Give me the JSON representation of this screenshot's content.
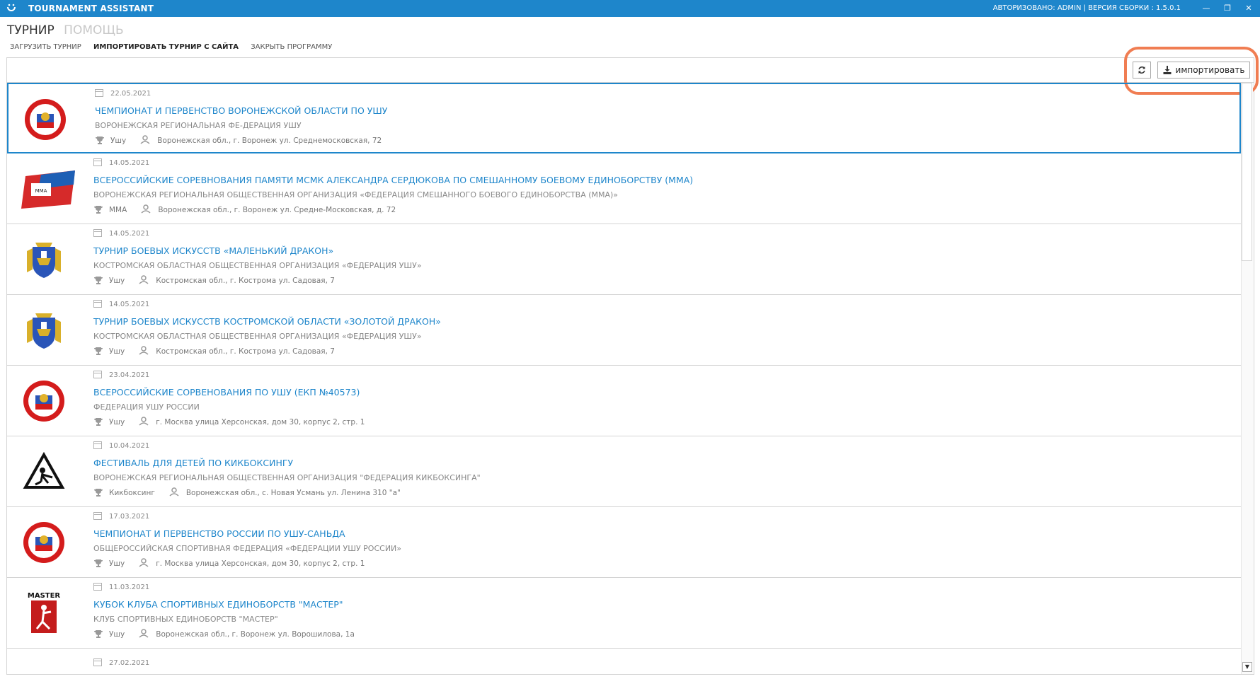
{
  "titlebar": {
    "app_title": "TOURNAMENT ASSISTANT",
    "auth_text": "АВТОРИЗОВАНО: ADMIN | ВЕРСИЯ СБОРКИ : 1.5.0.1",
    "minimize": "—",
    "restore": "❐",
    "close": "✕"
  },
  "menu": {
    "main": [
      "ТУРНИР",
      "ПОМОЩЬ"
    ],
    "sub": [
      "ЗАГРУЗИТЬ ТУРНИР",
      "ИМПОРТИРОВАТЬ ТУРНИР С САЙТА",
      "ЗАКРЫТЬ ПРОГРАММУ"
    ]
  },
  "toolbar": {
    "refresh_icon": "refresh-icon",
    "import_label": "импортировать"
  },
  "tournaments": [
    {
      "date": "22.05.2021",
      "title": "ЧЕМПИОНАТ И ПЕРВЕНСТВО ВОРОНЕЖСКОЙ ОБЛАСТИ ПО УШУ",
      "org": "ВОРОНЕЖСКАЯ РЕГИОНАЛЬНАЯ ФЕ-ДЕРАЦИЯ УШУ",
      "sport": "Ушу",
      "address": "Воронежская обл., г. Воронеж ул. Среднемосковская, 72",
      "logo": "wushu-federation-logo"
    },
    {
      "date": "14.05.2021",
      "title": "ВСЕРОССИЙСКИЕ СОРЕВНОВАНИЯ ПАМЯТИ МСМК АЛЕКСАНДРА СЕРДЮКОВА ПО СМЕШАННОМУ БОЕВОМУ ЕДИНОБОРСТВУ (ММА)",
      "org": "ВОРОНЕЖСКАЯ РЕГИОНАЛЬНАЯ ОБЩЕСТВЕННАЯ ОРГАНИЗАЦИЯ «ФЕДЕРАЦИЯ СМЕШАННОГО БОЕВОГО ЕДИНОБОРСТВА (ММА)»",
      "sport": "ММА",
      "address": "Воронежская обл., г. Воронеж ул. Средне-Московская, д. 72",
      "logo": "mma-union-logo"
    },
    {
      "date": "14.05.2021",
      "title": "ТУРНИР БОЕВЫХ ИСКУССТВ «МАЛЕНЬКИЙ ДРАКОН»",
      "org": "КОСТРОМСКАЯ ОБЛАСТНАЯ ОБЩЕСТВЕННАЯ ОРГАНИЗАЦИЯ «ФЕДЕРАЦИЯ УШУ»",
      "sport": "Ушу",
      "address": "Костромская обл., г. Кострома ул. Садовая, 7",
      "logo": "kostroma-coat-of-arms"
    },
    {
      "date": "14.05.2021",
      "title": "ТУРНИР БОЕВЫХ ИСКУССТВ КОСТРОМСКОЙ ОБЛАСТИ «ЗОЛОТОЙ ДРАКОН»",
      "org": "КОСТРОМСКАЯ ОБЛАСТНАЯ ОБЩЕСТВЕННАЯ ОРГАНИЗАЦИЯ «ФЕДЕРАЦИЯ УШУ»",
      "sport": "Ушу",
      "address": "Костромская обл., г. Кострома ул. Садовая, 7",
      "logo": "kostroma-coat-of-arms"
    },
    {
      "date": "23.04.2021",
      "title": "ВСЕРОССИЙСКИЕ СОРВЕНОВАНИЯ ПО УШУ (ЕКП №40573)",
      "org": "ФЕДЕРАЦИЯ УШУ РОССИИ",
      "sport": "Ушу",
      "address": "г. Москва улица Херсонская, дом 30, корпус 2, стр. 1",
      "logo": "wushu-federation-logo"
    },
    {
      "date": "10.04.2021",
      "title": "ФЕСТИВАЛЬ ДЛЯ ДЕТЕЙ ПО КИКБОКСИНГУ",
      "org": "ВОРОНЕЖСКАЯ РЕГИОНАЛЬНАЯ ОБЩЕСТВЕННАЯ ОРГАНИЗАЦИЯ \"ФЕДЕРАЦИЯ КИКБОКСИНГА\"",
      "sport": "Кикбоксинг",
      "address": "Воронежская обл., с. Новая Усмань ул. Ленина 310 \"а\"",
      "logo": "kickboxing-logo"
    },
    {
      "date": "17.03.2021",
      "title": "ЧЕМПИОНАТ И ПЕРВЕНСТВО РОССИИ ПО УШУ-САНЬДА",
      "org": "ОБЩЕРОССИЙСКАЯ СПОРТИВНАЯ ФЕДЕРАЦИЯ «ФЕДЕРАЦИИ УШУ РОССИИ»",
      "sport": "Ушу",
      "address": "г. Москва улица Херсонская, дом 30, корпус 2, стр. 1",
      "logo": "wushu-federation-logo"
    },
    {
      "date": "11.03.2021",
      "title": "КУБОК КЛУБА СПОРТИВНЫХ ЕДИНОБОРСТВ \"МАСТЕР\"",
      "org": "КЛУБ СПОРТИВНЫХ ЕДИНОБОРСТВ \"МАСТЕР\"",
      "sport": "Ушу",
      "address": "Воронежская обл., г. Воронеж ул. Ворошилова, 1а",
      "logo": "master-club-logo"
    }
  ],
  "partial_row": {
    "date": "27.02.2021"
  },
  "colors": {
    "accent": "#1e86cb",
    "highlight": "#f07d52"
  }
}
